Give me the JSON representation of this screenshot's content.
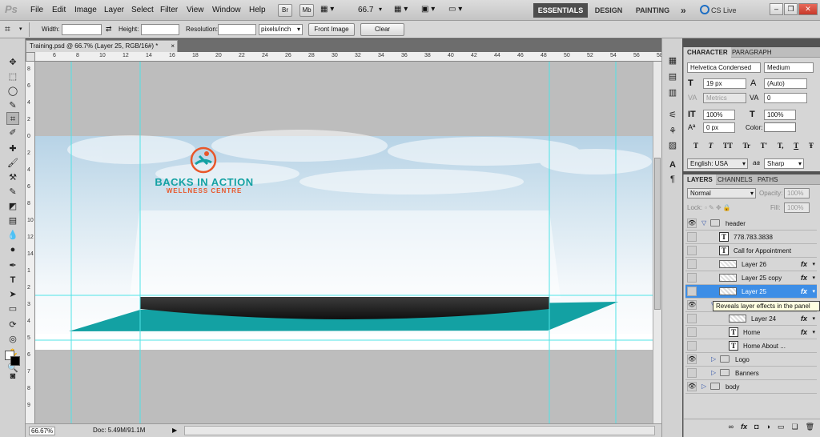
{
  "app": {
    "logo": "Ps"
  },
  "menu": [
    "File",
    "Edit",
    "Image",
    "Layer",
    "Select",
    "Filter",
    "View",
    "Window",
    "Help"
  ],
  "menubar_buttons": {
    "bridge": "Br",
    "mini_bridge": "Mb",
    "zoom": "66.7"
  },
  "workspaces": {
    "essentials": "ESSENTIALS",
    "design": "DESIGN",
    "painting": "PAINTING",
    "more": "»",
    "cs_live": "CS Live"
  },
  "window_controls": {
    "minimize": "–",
    "restore": "❐",
    "close": "✕"
  },
  "options": {
    "width_label": "Width:",
    "height_label": "Height:",
    "resolution_label": "Resolution:",
    "units": "pixels/inch",
    "front_image": "Front Image",
    "clear": "Clear",
    "width_value": "",
    "height_value": "",
    "resolution_value": ""
  },
  "document": {
    "tab": "Training.psd @ 66.7% (Layer 25, RGB/16#) *",
    "close": "×"
  },
  "ruler_top": [
    "6",
    "8",
    "10",
    "12",
    "14",
    "16",
    "18",
    "20",
    "22",
    "24",
    "26",
    "28",
    "30",
    "32",
    "34",
    "36",
    "38",
    "40",
    "42",
    "44",
    "46",
    "48",
    "50",
    "52",
    "54",
    "56",
    "58"
  ],
  "ruler_left": [
    "8",
    "6",
    "4",
    "2",
    "0",
    "2",
    "4",
    "6",
    "8",
    "10",
    "12",
    "14",
    "1",
    "2",
    "3",
    "4",
    "5",
    "6",
    "7",
    "8",
    "9"
  ],
  "status": {
    "zoom": "66.67%",
    "doc": "Doc: 5.49M/91.1M"
  },
  "canvas": {
    "brand_name": "BACKS IN ACTION",
    "brand_tagline": "WELLNESS CENTRE",
    "colors": {
      "teal": "#12a0a3",
      "orange": "#e8572a",
      "dark": "#1b1b1b"
    }
  },
  "character": {
    "tab_character": "CHARACTER",
    "tab_paragraph": "PARAGRAPH",
    "font_family": "Helvetica Condensed",
    "font_style": "Medium",
    "font_size": "19 px",
    "leading": "(Auto)",
    "kerning": "Metrics",
    "tracking": "0",
    "v_scale": "100%",
    "h_scale": "100%",
    "baseline": "0 px",
    "color_label": "Color:",
    "type_buttons": [
      "T",
      "T",
      "TT",
      "Tr",
      "T'",
      "T,",
      "T",
      "Ŧ"
    ],
    "language": "English: USA",
    "aa_icon": "aa",
    "antialias": "Sharp"
  },
  "layers": {
    "tab_layers": "LAYERS",
    "tab_channels": "CHANNELS",
    "tab_paths": "PATHS",
    "blend_mode": "Normal",
    "opacity_label": "Opacity:",
    "opacity": "100%",
    "lock_label": "Lock:",
    "fill_label": "Fill:",
    "fill": "100%",
    "rows": [
      {
        "name": "header",
        "kind": "group",
        "open": true,
        "visible": true,
        "indent": 0
      },
      {
        "name": "778.783.3838",
        "kind": "text",
        "visible": false,
        "indent": 1
      },
      {
        "name": "Call for Appointment",
        "kind": "text",
        "visible": false,
        "indent": 1
      },
      {
        "name": "Layer 26",
        "kind": "pixel",
        "visible": false,
        "indent": 1,
        "fx": true
      },
      {
        "name": "Layer 25 copy",
        "kind": "pixel",
        "visible": false,
        "indent": 1,
        "fx": true
      },
      {
        "name": "Layer 25",
        "kind": "pixel",
        "visible": false,
        "indent": 1,
        "fx": true,
        "selected": true
      },
      {
        "name": "",
        "kind": "group",
        "open": true,
        "visible": true,
        "indent": 1
      },
      {
        "name": "Layer 24",
        "kind": "pixel",
        "visible": false,
        "indent": 2,
        "fx": true
      },
      {
        "name": "Home",
        "kind": "text",
        "visible": false,
        "indent": 2,
        "fx": true
      },
      {
        "name": "Home        About       ...",
        "kind": "text",
        "visible": false,
        "indent": 2
      },
      {
        "name": "Logo",
        "kind": "group",
        "open": false,
        "visible": true,
        "indent": 1
      },
      {
        "name": "Banners",
        "kind": "group",
        "open": false,
        "visible": false,
        "indent": 1
      },
      {
        "name": "body",
        "kind": "group",
        "open": false,
        "visible": true,
        "indent": 0
      }
    ],
    "fx_label": "fx",
    "tooltip": "Reveals layer effects in the panel",
    "footer_icons": [
      "∞",
      "fx",
      "◘",
      "◑",
      "▭",
      "❏",
      "🗑"
    ]
  }
}
